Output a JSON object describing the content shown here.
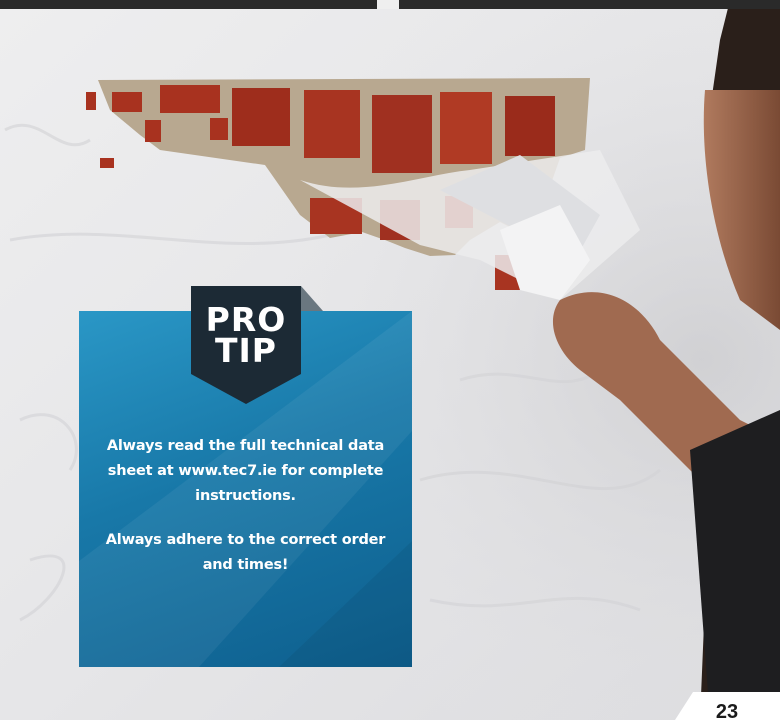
{
  "pro_tip": {
    "badge_line1": "PRO",
    "badge_line2": "TIP",
    "paragraphs": [
      "Always read the full technical data sheet at www.tec7.ie for complete instructions.",
      "Always adhere to the correct order and times!"
    ]
  },
  "page_number": "23",
  "colors": {
    "panel_blue": "#1878a8",
    "badge_dark": "#1c2a35",
    "brick": "#a5301f",
    "plaster": "#e9e9ea"
  }
}
